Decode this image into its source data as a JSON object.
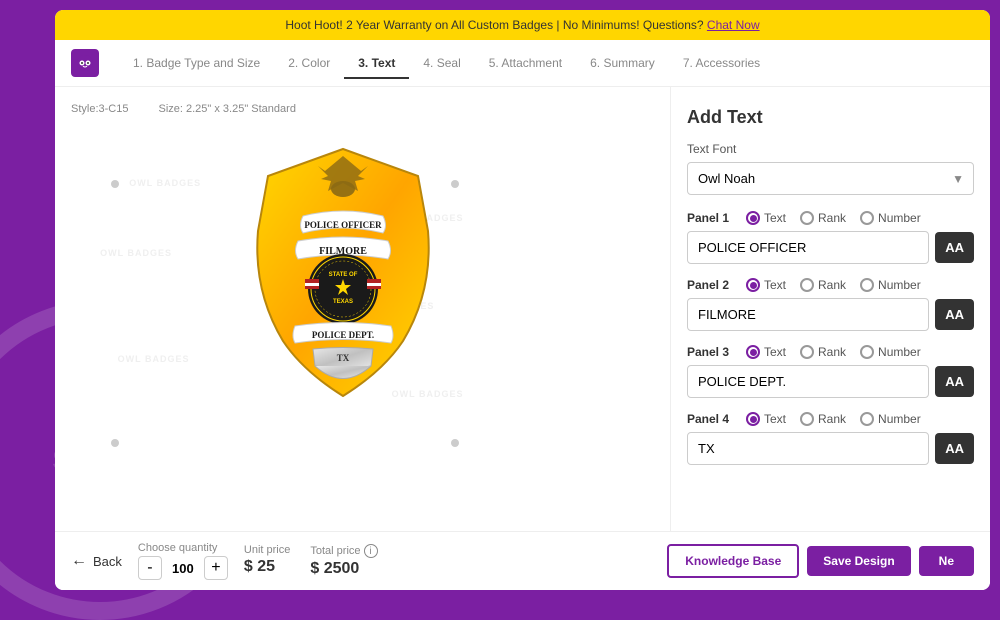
{
  "banner": {
    "text": "Hoot Hoot! 2 Year Warranty on All Custom Badges | No Minimums!  Questions?",
    "link_text": "Chat Now"
  },
  "nav": {
    "steps": [
      {
        "id": "badge-type",
        "label": "1. Badge Type and Size",
        "active": false
      },
      {
        "id": "color",
        "label": "2. Color",
        "active": false
      },
      {
        "id": "text",
        "label": "3. Text",
        "active": true
      },
      {
        "id": "seal",
        "label": "4. Seal",
        "active": false
      },
      {
        "id": "attachment",
        "label": "5. Attachment",
        "active": false
      },
      {
        "id": "summary",
        "label": "6. Summary",
        "active": false
      },
      {
        "id": "accessories",
        "label": "7. Accessories",
        "active": false
      }
    ]
  },
  "preview": {
    "style_label": "Style:3-C15",
    "size_label": "Size: 2.25\" x 3.25\" Standard"
  },
  "add_text": {
    "title": "Add Text",
    "font_label": "Text Font",
    "font_value": "Owl Noah",
    "panels": [
      {
        "label": "Panel 1",
        "options": [
          "Text",
          "Rank",
          "Number"
        ],
        "selected": "Text",
        "value": "POLICE OFFICER"
      },
      {
        "label": "Panel 2",
        "options": [
          "Text",
          "Rank",
          "Number"
        ],
        "selected": "Text",
        "value": "FILMORE"
      },
      {
        "label": "Panel 3",
        "options": [
          "Text",
          "Rank",
          "Number"
        ],
        "selected": "Text",
        "value": "POLICE DEPT."
      },
      {
        "label": "Panel 4",
        "options": [
          "Text",
          "Rank",
          "Number"
        ],
        "selected": "Text",
        "value": "TX"
      }
    ],
    "aa_button_label": "AA"
  },
  "bottom": {
    "back_label": "Back",
    "quantity_label": "Choose quantity",
    "quantity_value": "100",
    "unit_price_label": "Unit price",
    "unit_price_value": "$ 25",
    "total_price_label": "Total price",
    "total_price_value": "$ 2500",
    "knowledge_btn": "Knowledge Base",
    "save_btn": "Save Design",
    "next_btn": "Ne"
  },
  "colors": {
    "brand_purple": "#7B1FA2",
    "banner_yellow": "#FFD600"
  }
}
